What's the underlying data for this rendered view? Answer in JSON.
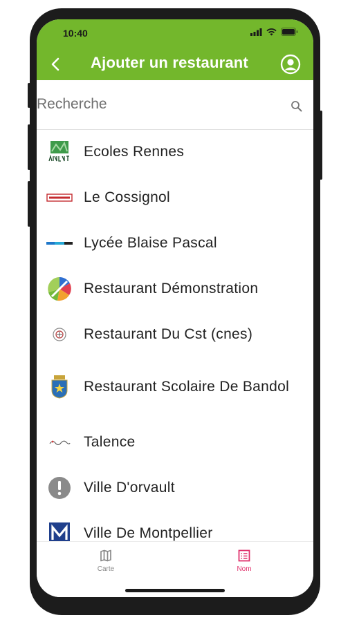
{
  "status_bar": {
    "time": "10:40"
  },
  "header": {
    "title": "Ajouter un restaurant"
  },
  "search": {
    "placeholder": "Recherche"
  },
  "restaurants": [
    {
      "name": "Ecoles Rennes",
      "logo": "rennes-logo"
    },
    {
      "name": "Le Cossignol",
      "logo": "cossignol-logo"
    },
    {
      "name": "Lycée Blaise Pascal",
      "logo": "blaise-pascal-logo"
    },
    {
      "name": "Restaurant Démonstration",
      "logo": "demonstration-logo"
    },
    {
      "name": "Restaurant Du Cst (cnes)",
      "logo": "cnes-logo"
    },
    {
      "name": "Restaurant Scolaire De Bandol",
      "logo": "bandol-crest-logo"
    },
    {
      "name": "Talence",
      "logo": "talence-logo"
    },
    {
      "name": "Ville D'orvault",
      "logo": "exclamation-icon"
    },
    {
      "name": "Ville De Montpellier",
      "logo": "montpellier-logo"
    }
  ],
  "bottom_nav": {
    "carte": "Carte",
    "nom": "Nom",
    "active": "Nom"
  },
  "colors": {
    "header": "#73b72c",
    "active_tab": "#e0306b",
    "inactive_tab": "#8a8a8a"
  }
}
